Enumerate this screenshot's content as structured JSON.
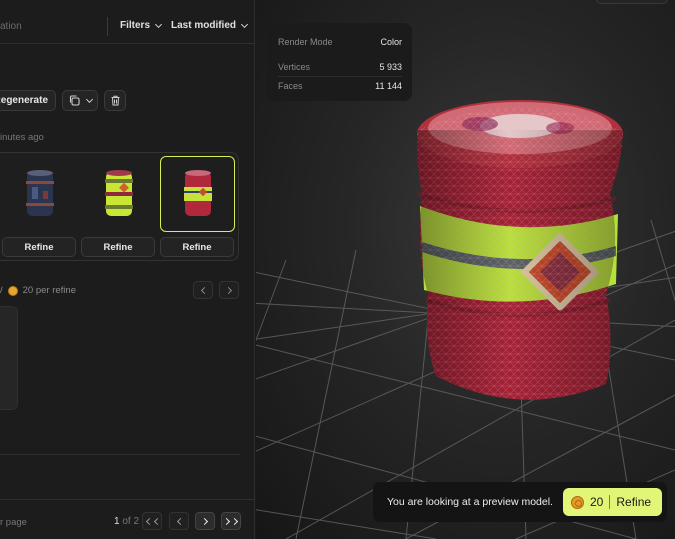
{
  "sidebar": {
    "search_placeholder": "ation",
    "filters_label": "Filters",
    "sort_label": "Last modified",
    "regenerate_label": "Regenerate",
    "timestamp": "inutes ago",
    "variants": [
      {
        "refine_label": "Refine",
        "selected": false
      },
      {
        "refine_label": "Refine",
        "selected": false
      },
      {
        "refine_label": "Refine",
        "selected": true
      }
    ],
    "cost_slash": "/",
    "cost_text": "20 per refine",
    "footer": {
      "per_page": "r page",
      "current_page": "1",
      "total_text": "of 2"
    }
  },
  "viewer": {
    "info": {
      "render_mode_label": "Render Mode",
      "render_mode_value": "Color",
      "vertices_label": "Vertices",
      "vertices_value": "5 933",
      "faces_label": "Faces",
      "faces_value": "11 144"
    },
    "notice_text": "You are looking at a preview model.",
    "refine_cost": "20",
    "refine_label": "Refine"
  },
  "colors": {
    "accent": "#e3f576",
    "selected_border": "#d6ef55",
    "coin": "#e69a24"
  }
}
